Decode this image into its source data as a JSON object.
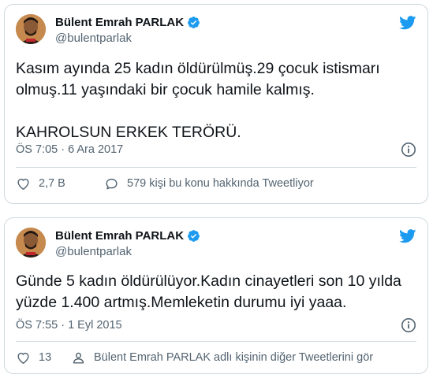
{
  "colors": {
    "accent": "#1d9bf0",
    "text": "#0f1419",
    "muted": "#536471",
    "border": "#cfd9de"
  },
  "tweets": [
    {
      "display_name": "Bülent Emrah PARLAK",
      "handle": "@bulentparlak",
      "text": "Kasım ayında 25 kadın öldürülmüş.29 çocuk istismarı olmuş.11 yaşındaki bir çocuk hamile kalmış.\n\nKAHROLSUN ERKEK TERÖRÜ.",
      "timestamp": "ÖS 7:05 · 6 Ara 2017",
      "like_count": "2,7 B",
      "secondary_action": "579 kişi bu konu hakkında Tweetliyor",
      "icons": [
        "verified-badge-icon",
        "twitter-bird-icon",
        "info-icon",
        "heart-icon",
        "speech-bubble-icon"
      ]
    },
    {
      "display_name": "Bülent Emrah PARLAK",
      "handle": "@bulentparlak",
      "text": "Günde 5 kadın öldürülüyor.Kadın cinayetleri son 10 yılda yüzde 1.400 artmış.Memleketin durumu iyi yaaa.",
      "timestamp": "ÖS 7:55 · 1 Eyl 2015",
      "like_count": "13",
      "secondary_action": "Bülent Emrah PARLAK adlı kişinin diğer Tweetlerini gör",
      "icons": [
        "verified-badge-icon",
        "twitter-bird-icon",
        "info-icon",
        "heart-icon",
        "person-icon"
      ]
    }
  ]
}
